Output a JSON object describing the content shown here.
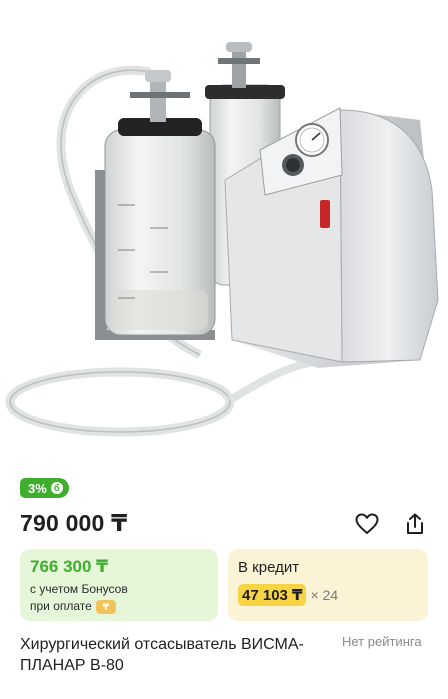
{
  "product": {
    "image_alt_icon": "surgical-aspirator-photo",
    "bonus_badge": "3%",
    "bonus_badge_icon": "б",
    "price": "790 000 ₸",
    "bonus_card": {
      "price": "766 300 ₸",
      "note_line1": "с учетом Бонусов",
      "note_line2": "при оплате",
      "coin_icon": "coin-icon"
    },
    "credit_card": {
      "title": "В кредит",
      "monthly": "47 103 ₸",
      "times": "× 24"
    },
    "title": "Хирургический отсасыватель ВИСМА-ПЛАНАР В-80",
    "rating_text": "Нет рейтинга"
  },
  "colors": {
    "accent_green": "#3fae2e",
    "bonus_bg": "#e6f6d9",
    "credit_bg": "#fbf3d6",
    "credit_highlight": "#f7d443"
  },
  "icons": {
    "favorite": "heart-outline-icon",
    "share": "share-icon"
  }
}
